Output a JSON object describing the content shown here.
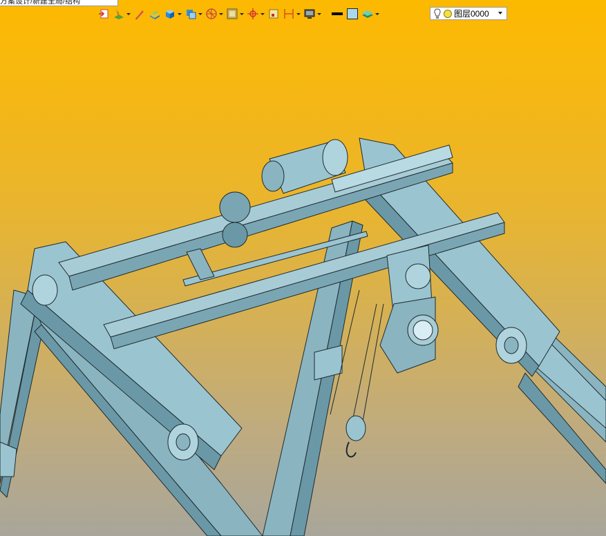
{
  "tab": {
    "title": "方案设计/新建全局/结构"
  },
  "toolbar": {
    "buttons": [
      {
        "name": "exit-sketch-icon",
        "dropdown": false
      },
      {
        "name": "sketch-plane-icon",
        "dropdown": true
      },
      {
        "name": "pencil-icon",
        "dropdown": false
      },
      {
        "name": "extrude-icon",
        "dropdown": false
      },
      {
        "name": "solid-cube-icon",
        "dropdown": true
      },
      {
        "name": "view-cube-icon",
        "dropdown": true
      },
      {
        "name": "compass-icon",
        "dropdown": true
      },
      {
        "name": "sheet-icon",
        "dropdown": true
      },
      {
        "name": "coordinate-icon",
        "dropdown": true
      },
      {
        "name": "frame-icon",
        "dropdown": false
      },
      {
        "name": "dimension-icon",
        "dropdown": true
      },
      {
        "name": "monitor-icon",
        "dropdown": true
      },
      {
        "name": "line-style-icon",
        "dropdown": false
      },
      {
        "name": "fill-color-icon",
        "dropdown": false
      },
      {
        "name": "layers-icon",
        "dropdown": true
      }
    ],
    "accent": "#fdb900"
  },
  "layer": {
    "label": "图层0000",
    "bulb_icon": "lightbulb-icon",
    "status_icon": "layer-status-icon"
  },
  "viewport": {
    "model_color": "#8ab8c4",
    "edge_color": "#1e2a2e"
  }
}
